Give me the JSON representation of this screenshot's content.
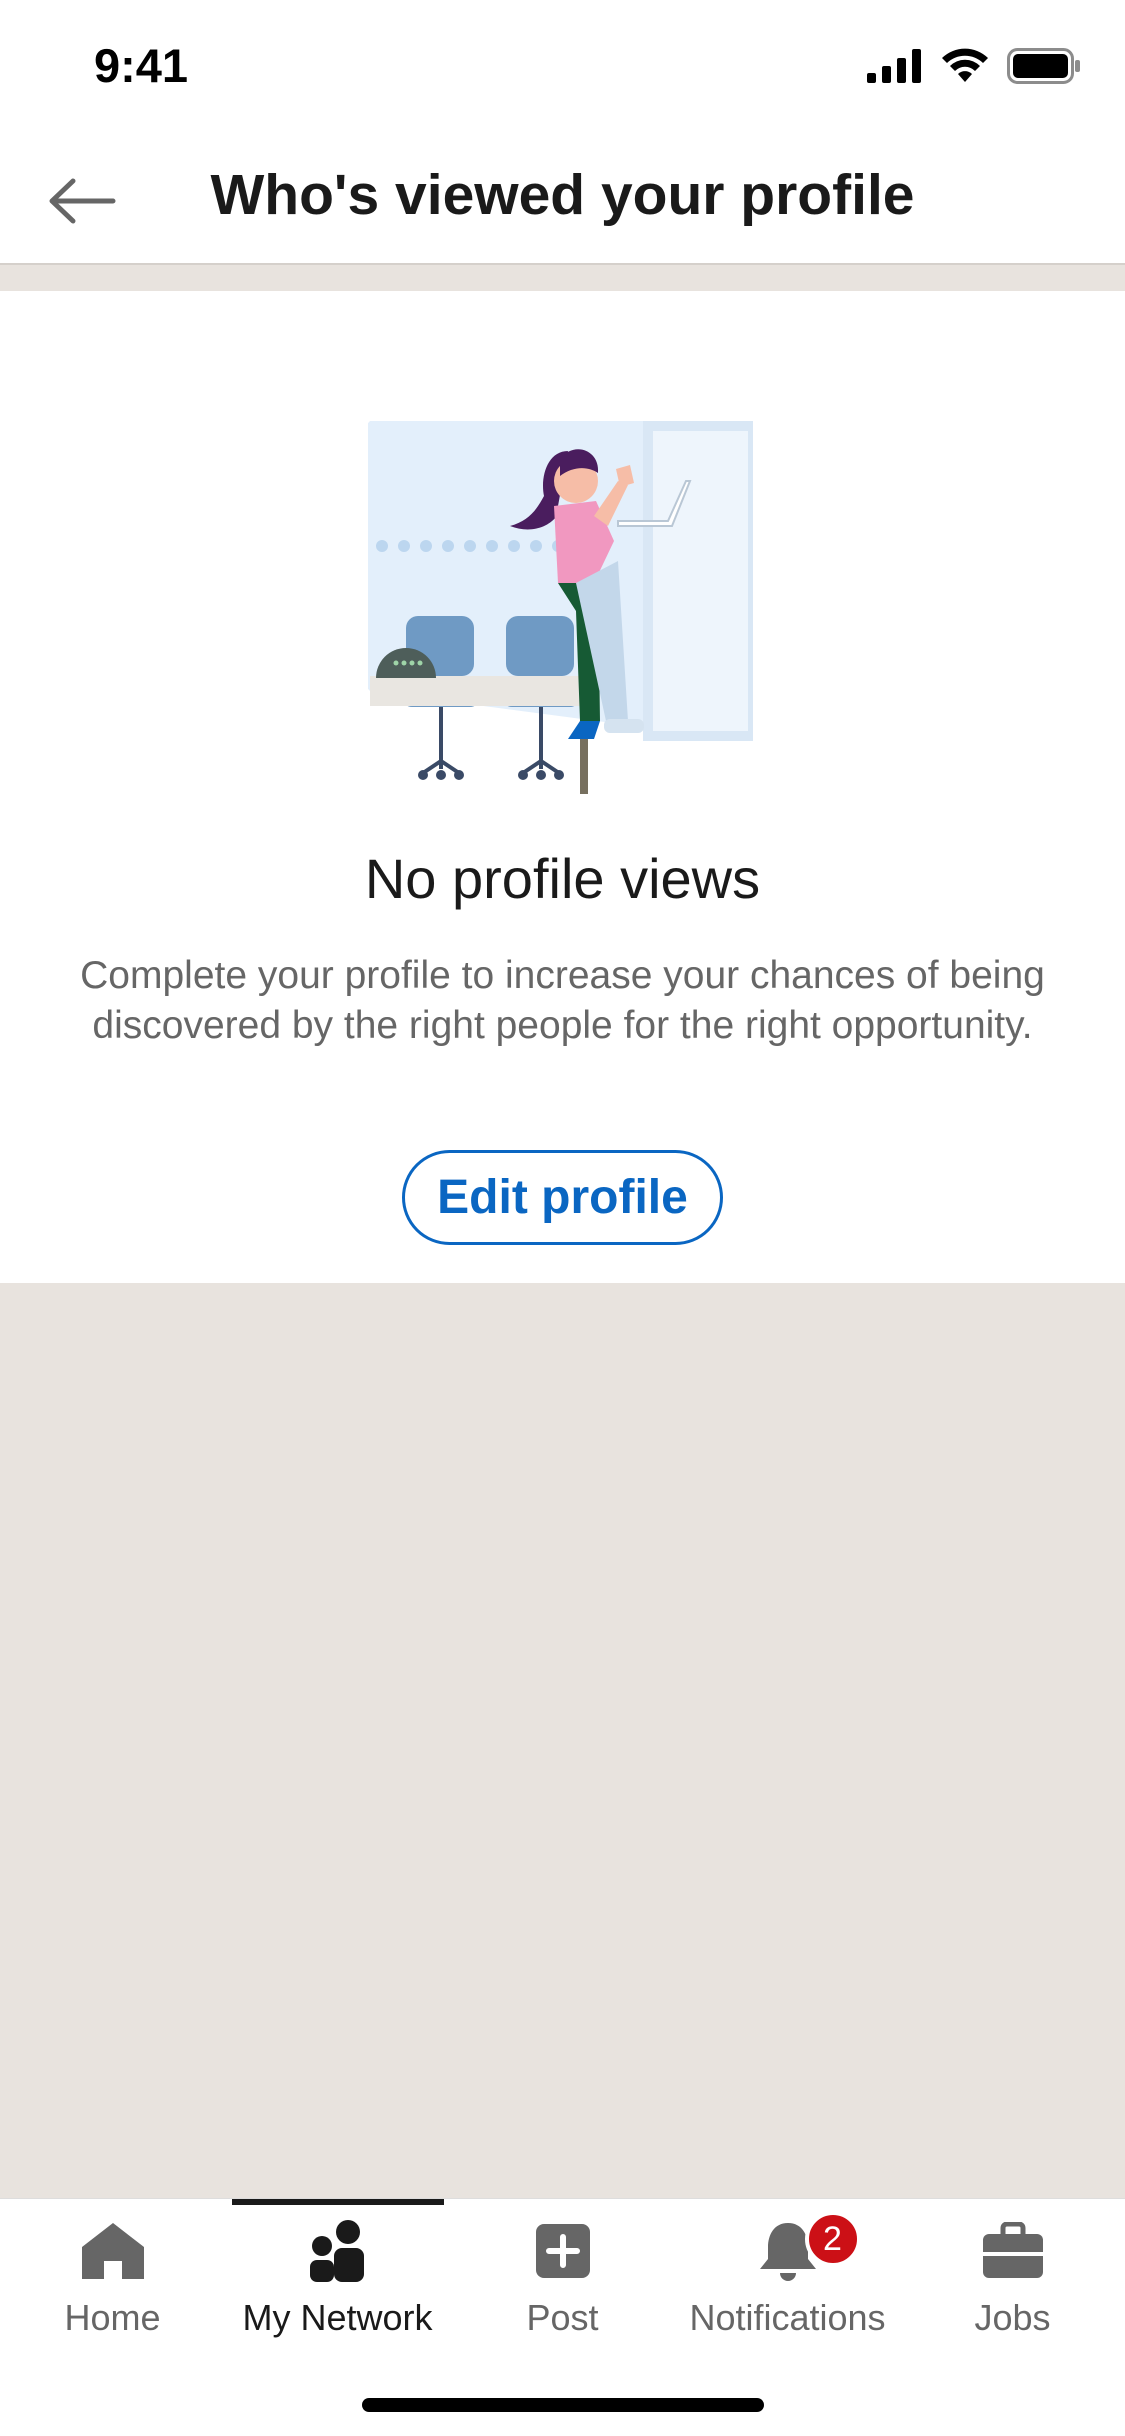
{
  "status_bar": {
    "time": "9:41"
  },
  "header": {
    "title": "Who's viewed your profile"
  },
  "empty_state": {
    "title": "No profile views",
    "description": "Complete your profile to increase your chances of being discovered by the right people for the right opportunity.",
    "button_label": "Edit profile"
  },
  "bottom_nav": {
    "items": [
      {
        "label": "Home",
        "icon": "home-icon"
      },
      {
        "label": "My Network",
        "icon": "people-icon",
        "active": true
      },
      {
        "label": "Post",
        "icon": "plus-square-icon"
      },
      {
        "label": "Notifications",
        "icon": "bell-icon",
        "badge": "2"
      },
      {
        "label": "Jobs",
        "icon": "briefcase-icon"
      }
    ]
  },
  "colors": {
    "accent": "#0a66c2",
    "background": "#e8e3de",
    "badge": "#cc1016"
  }
}
